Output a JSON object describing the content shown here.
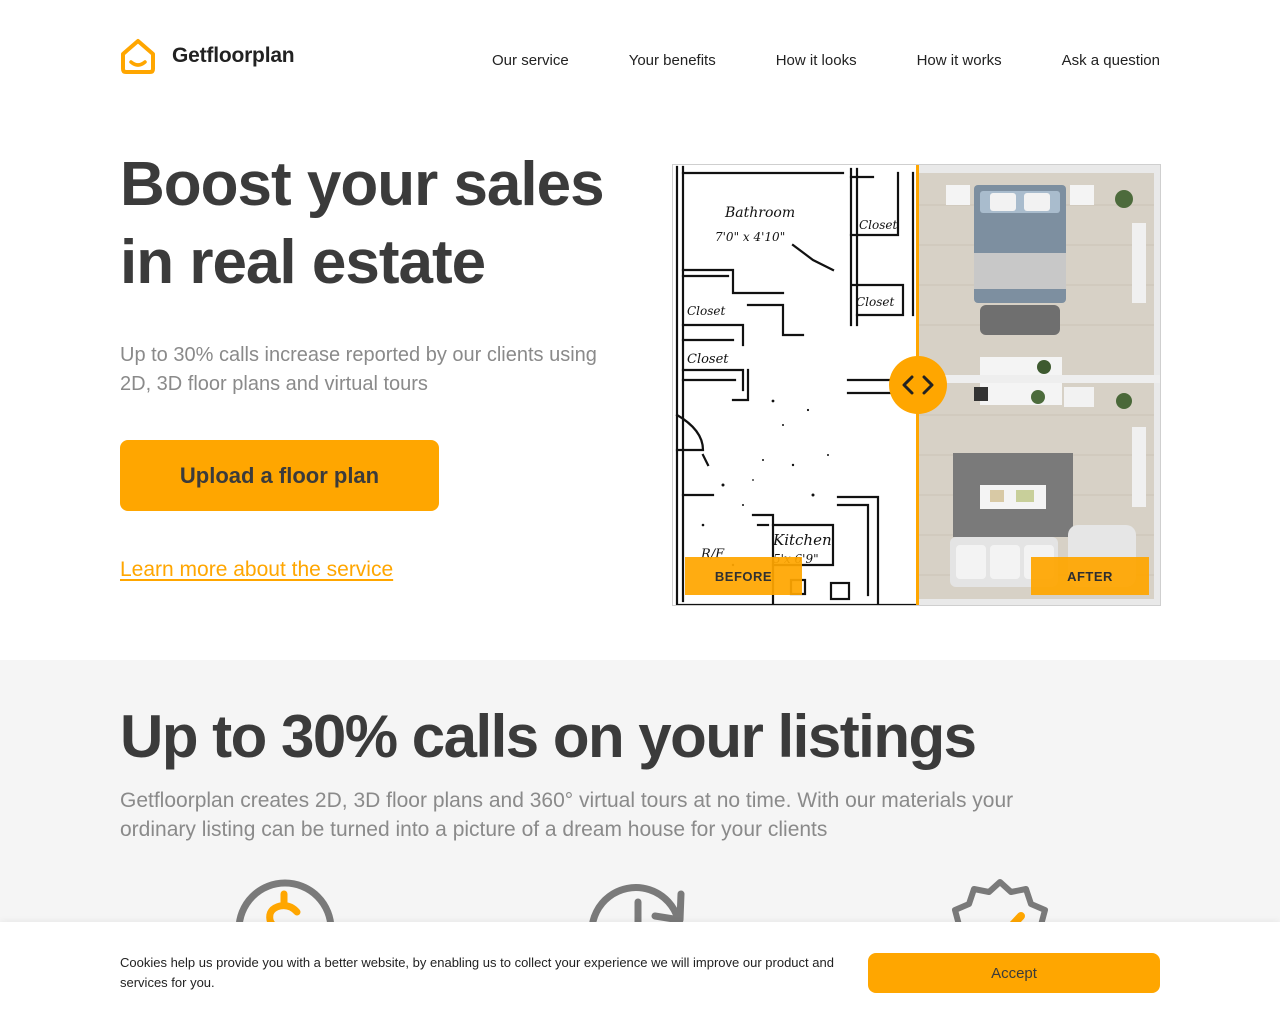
{
  "brand": {
    "name": "Getfloorplan",
    "accent": "#ffa600"
  },
  "nav": {
    "items": [
      {
        "label": "Our service"
      },
      {
        "label": "Your benefits"
      },
      {
        "label": "How it looks"
      },
      {
        "label": "How it works"
      },
      {
        "label": "Ask a question"
      }
    ]
  },
  "hero": {
    "title_line1": "Boost your sales",
    "title_line2": "in real estate",
    "subtitle": "Up to 30% calls increase reported by our clients using 2D, 3D floor plans and virtual tours",
    "upload_label": "Upload a floor plan",
    "learn_more_label": "Learn more about the service"
  },
  "compare": {
    "before_label": "BEFORE",
    "after_label": "AFTER",
    "sketch_labels": {
      "bathroom": "Bathroom",
      "bathroom_size": "7'0\" x 4'10\"",
      "closet_top": "Closet",
      "closet_mid": "Closet",
      "closet_left1": "Closet",
      "closet_left2": "Closet",
      "kitchen": "Kitchen",
      "kitchen_size": "5'x 6'9\"",
      "rf": "R/F"
    }
  },
  "section2": {
    "title": "Up to 30% calls on your listings",
    "text": "Getfloorplan creates 2D, 3D floor plans and 360° virtual tours at no time. With our materials your ordinary listing can be turned into a picture of a dream house for your clients"
  },
  "features": [
    {
      "icon": "dollar-coin-icon"
    },
    {
      "icon": "clock-refresh-icon"
    },
    {
      "icon": "quality-badge-icon"
    }
  ],
  "cookie": {
    "text": "Cookies help us provide you with a better website, by enabling us to collect your experience we will improve our product and services for you.",
    "accept_label": "Accept"
  }
}
